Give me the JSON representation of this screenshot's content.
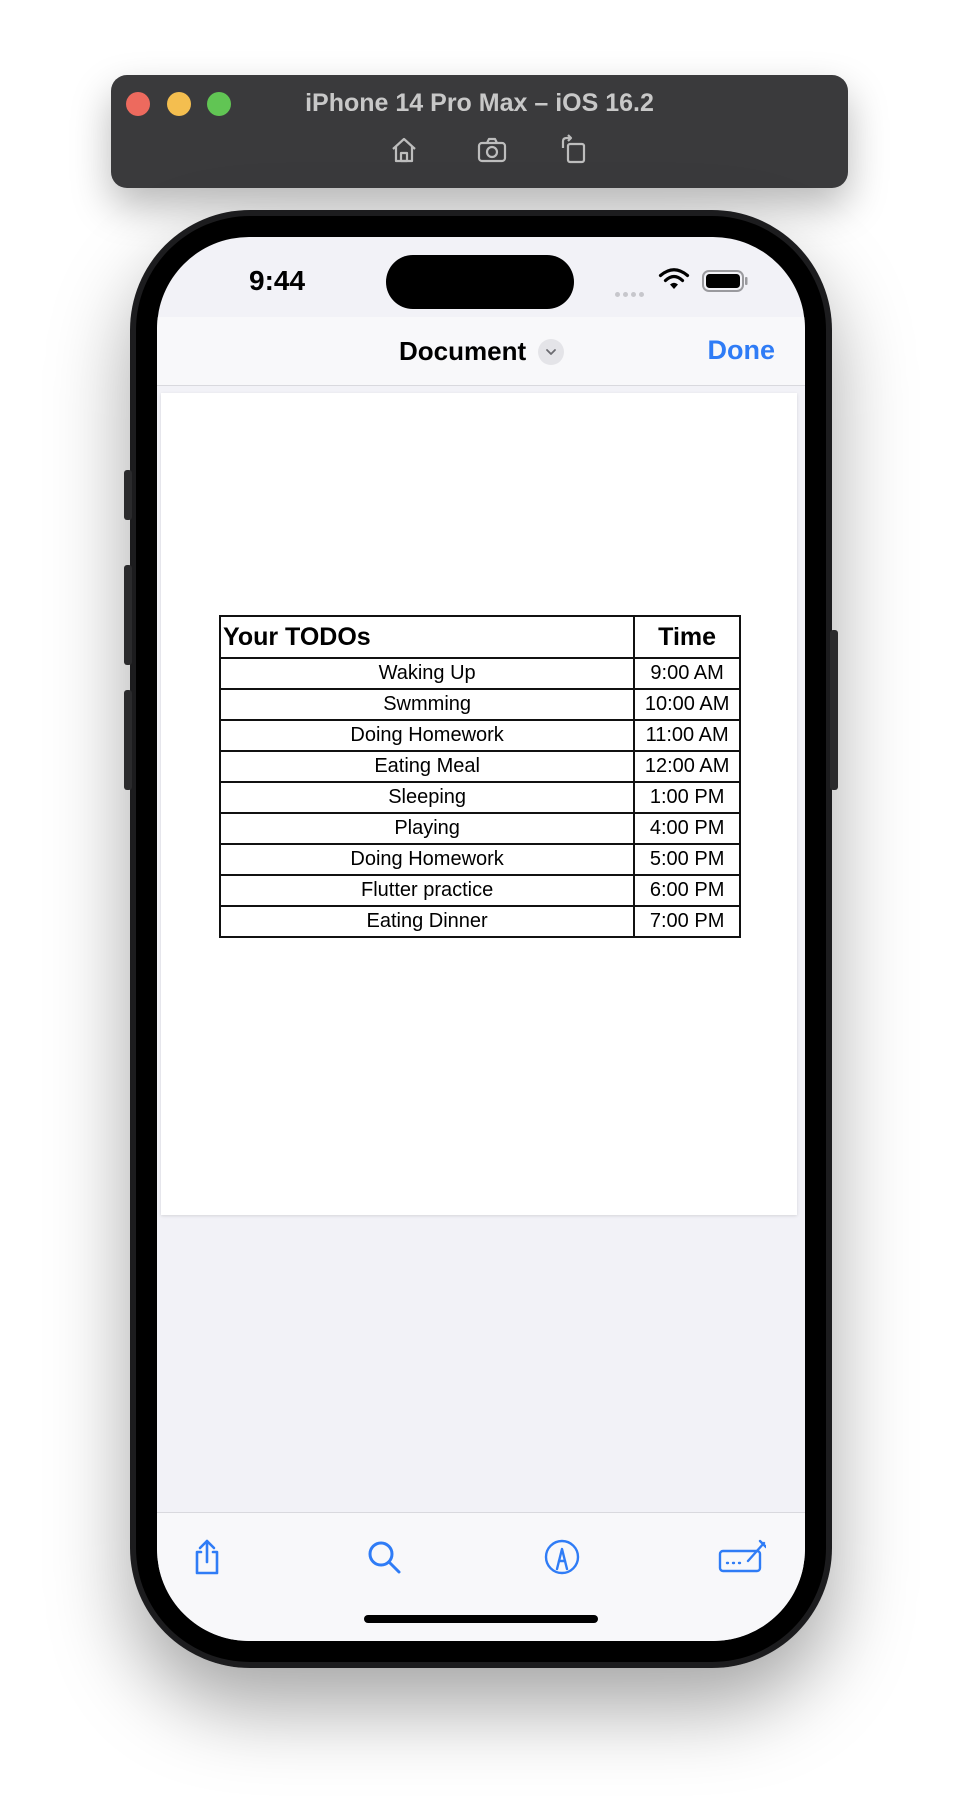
{
  "simulator": {
    "title": "iPhone 14 Pro Max – iOS 16.2",
    "buttons": [
      "home-icon",
      "screenshot-icon",
      "rotate-icon"
    ]
  },
  "status_bar": {
    "time": "9:44"
  },
  "nav": {
    "title": "Document",
    "done_label": "Done"
  },
  "document": {
    "headers": {
      "task": "Your TODOs",
      "time": "Time"
    },
    "rows": [
      {
        "task": "Waking Up",
        "time": "9:00 AM"
      },
      {
        "task": "Swmming",
        "time": "10:00 AM"
      },
      {
        "task": "Doing Homework",
        "time": "11:00 AM"
      },
      {
        "task": "Eating Meal",
        "time": "12:00 AM"
      },
      {
        "task": "Sleeping",
        "time": "1:00 PM"
      },
      {
        "task": "Playing",
        "time": "4:00 PM"
      },
      {
        "task": "Doing Homework",
        "time": "5:00 PM"
      },
      {
        "task": "Flutter practice",
        "time": "6:00 PM"
      },
      {
        "task": "Eating Dinner",
        "time": "7:00 PM"
      }
    ]
  },
  "toolbar": [
    "share-icon",
    "search-icon",
    "markup-icon",
    "signature-icon"
  ],
  "colors": {
    "accent": "#2f7cf6",
    "sim_bar": "#3a3a3c"
  }
}
